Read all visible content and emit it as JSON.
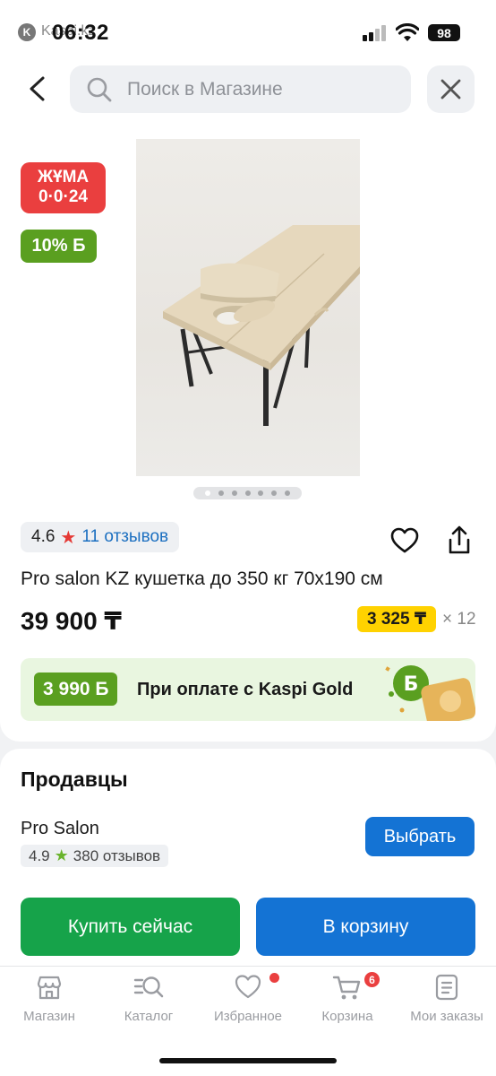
{
  "status_bar": {
    "carrier": "Kaspi.kz",
    "time": "06:32",
    "battery": "98"
  },
  "search": {
    "placeholder": "Поиск в Магазине"
  },
  "badges": {
    "promo": "ЖҰМА 0·0·24",
    "promo_line1": "ЖҰМА",
    "promo_line2": "0·0·24",
    "bonus": "10% Б"
  },
  "gallery": {
    "total_images": 7,
    "current_index": 1
  },
  "product": {
    "rating": "4.6",
    "reviews": "11 отзывов",
    "title": "Pro salon KZ кушетка до 350 кг 70х190 см",
    "price": "39 900 ₸",
    "installment": "3 325 ₸",
    "installment_months": "× 12"
  },
  "gold_banner": {
    "bonus": "3 990 Б",
    "text": "При оплате с Kaspi Gold"
  },
  "sellers": {
    "heading": "Продавцы",
    "items": [
      {
        "name": "Pro Salon",
        "rating": "4.9",
        "reviews": "380 отзывов",
        "button": "Выбрать"
      }
    ]
  },
  "actions": {
    "buy_now": "Купить сейчас",
    "add_to_cart": "В корзину"
  },
  "tabbar": {
    "items": [
      {
        "label": "Магазин",
        "icon": "store-icon"
      },
      {
        "label": "Каталог",
        "icon": "catalog-search-icon"
      },
      {
        "label": "Избранное",
        "icon": "heart-icon",
        "dot": true
      },
      {
        "label": "Корзина",
        "icon": "cart-icon",
        "badge": "6"
      },
      {
        "label": "Мои заказы",
        "icon": "orders-icon"
      }
    ]
  },
  "colors": {
    "primary_blue": "#1473d4",
    "buy_green": "#16a34a",
    "bonus_green": "#5a9f20",
    "promo_red": "#ea3f3f",
    "installment_yellow": "#ffd200"
  }
}
